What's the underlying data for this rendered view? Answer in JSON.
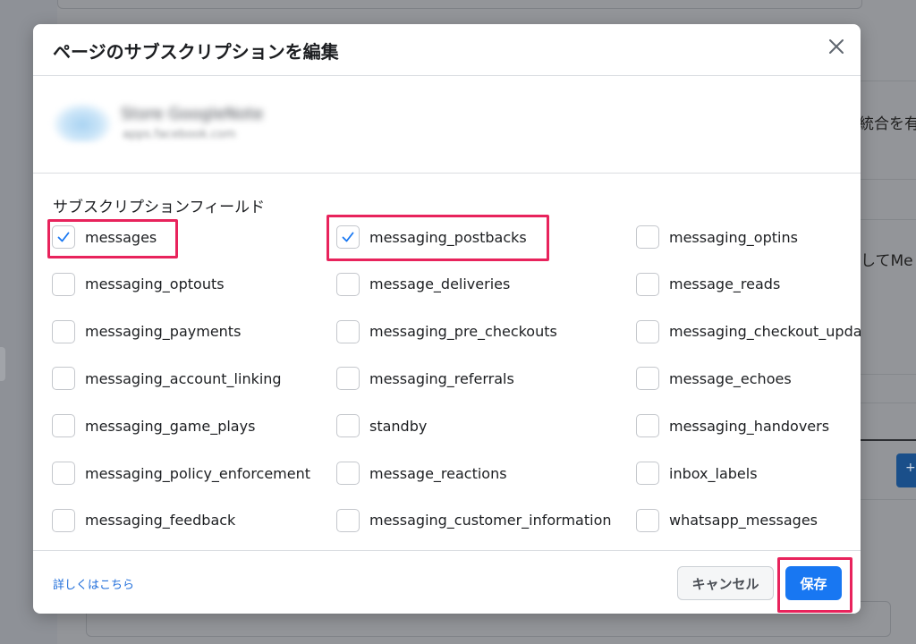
{
  "background": {
    "text_right_1": "統合を有",
    "text_right_2": "してMe"
  },
  "dialog": {
    "title": "ページのサブスクリプションを編集",
    "page": {
      "name": "Store GoogleNote",
      "subtitle": "apps.facebook.com"
    },
    "section_label": "サブスクリプションフィールド",
    "fields": [
      {
        "label": "messages",
        "checked": true
      },
      {
        "label": "messaging_postbacks",
        "checked": true
      },
      {
        "label": "messaging_optins",
        "checked": false
      },
      {
        "label": "messaging_optouts",
        "checked": false
      },
      {
        "label": "message_deliveries",
        "checked": false
      },
      {
        "label": "message_reads",
        "checked": false
      },
      {
        "label": "messaging_payments",
        "checked": false
      },
      {
        "label": "messaging_pre_checkouts",
        "checked": false
      },
      {
        "label": "messaging_checkout_updates",
        "checked": false
      },
      {
        "label": "messaging_account_linking",
        "checked": false
      },
      {
        "label": "messaging_referrals",
        "checked": false
      },
      {
        "label": "message_echoes",
        "checked": false
      },
      {
        "label": "messaging_game_plays",
        "checked": false
      },
      {
        "label": "standby",
        "checked": false
      },
      {
        "label": "messaging_handovers",
        "checked": false
      },
      {
        "label": "messaging_policy_enforcement",
        "checked": false
      },
      {
        "label": "message_reactions",
        "checked": false
      },
      {
        "label": "inbox_labels",
        "checked": false
      },
      {
        "label": "messaging_feedback",
        "checked": false
      },
      {
        "label": "messaging_customer_information",
        "checked": false
      },
      {
        "label": "whatsapp_messages",
        "checked": false
      }
    ],
    "footer": {
      "learn_more": "詳しくはこちら",
      "cancel_label": "キャンセル",
      "save_label": "保存"
    }
  },
  "colors": {
    "primary_button": "#1877f2",
    "highlight": "#e8235c",
    "check": "#1877f2",
    "link": "#216fdb"
  }
}
